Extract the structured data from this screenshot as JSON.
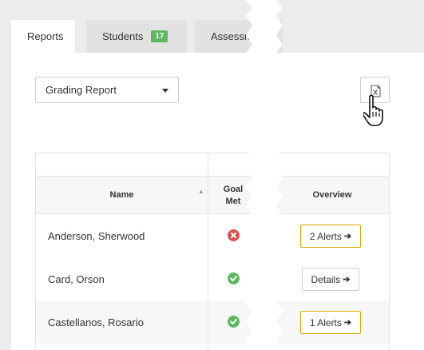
{
  "tabs": [
    {
      "label": "Reports",
      "active": true
    },
    {
      "label": "Students",
      "badge": "17"
    },
    {
      "label": "Assessm"
    }
  ],
  "toolbar": {
    "report_select": {
      "value": "Grading Report"
    },
    "excel_icon": "excel-file-icon",
    "cursor_icon": "hand-pointer-icon"
  },
  "table": {
    "columns": {
      "name": "Name",
      "goal_line1": "Goal",
      "goal_line2": "Met",
      "overview": "Overview"
    },
    "rows": [
      {
        "name": "Anderson, Sherwood",
        "goal_met": false,
        "overview": "2 Alerts",
        "overview_style": "warning"
      },
      {
        "name": "Card, Orson",
        "goal_met": true,
        "overview": "Details",
        "overview_style": "default"
      },
      {
        "name": "Castellanos, Rosario",
        "goal_met": true,
        "overview": "1 Alerts",
        "overview_style": "warning"
      }
    ]
  },
  "colors": {
    "success": "#5cb85c",
    "danger": "#d9534f",
    "warning_border": "#e0a800",
    "badge": "#5cb85c"
  }
}
